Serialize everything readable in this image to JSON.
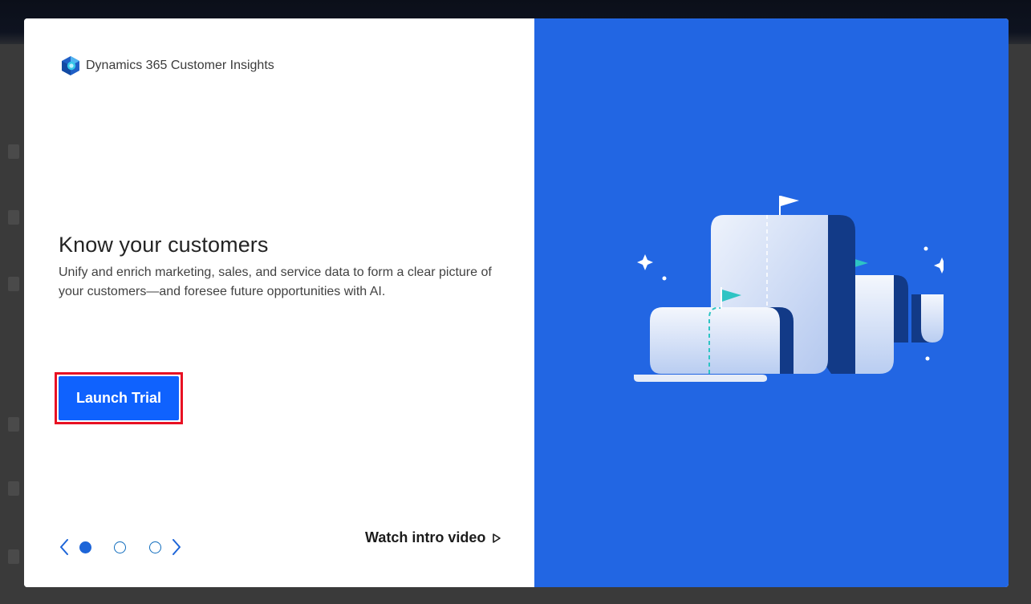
{
  "brand": {
    "name": "Dynamics 365 Customer Insights",
    "logo_icon": "dynamics-365-customer-insights-logo"
  },
  "hero": {
    "title": "Know your customers",
    "description": "Unify and enrich marketing, sales, and service data to form a clear picture of your customers—and foresee future opportunities with AI."
  },
  "actions": {
    "launch_label": "Launch Trial",
    "watch_label": "Watch intro video",
    "watch_icon": "play-icon"
  },
  "carousel": {
    "slide_count": 3,
    "active_index": 0,
    "prev_icon": "chevron-left-icon",
    "next_icon": "chevron-right-icon"
  },
  "colors": {
    "accent_blue": "#0f62fe",
    "panel_blue": "#2266e3",
    "highlight_outline": "#e81123",
    "illustration_navy": "#123a87",
    "flag_teal": "#2ec4c4"
  }
}
